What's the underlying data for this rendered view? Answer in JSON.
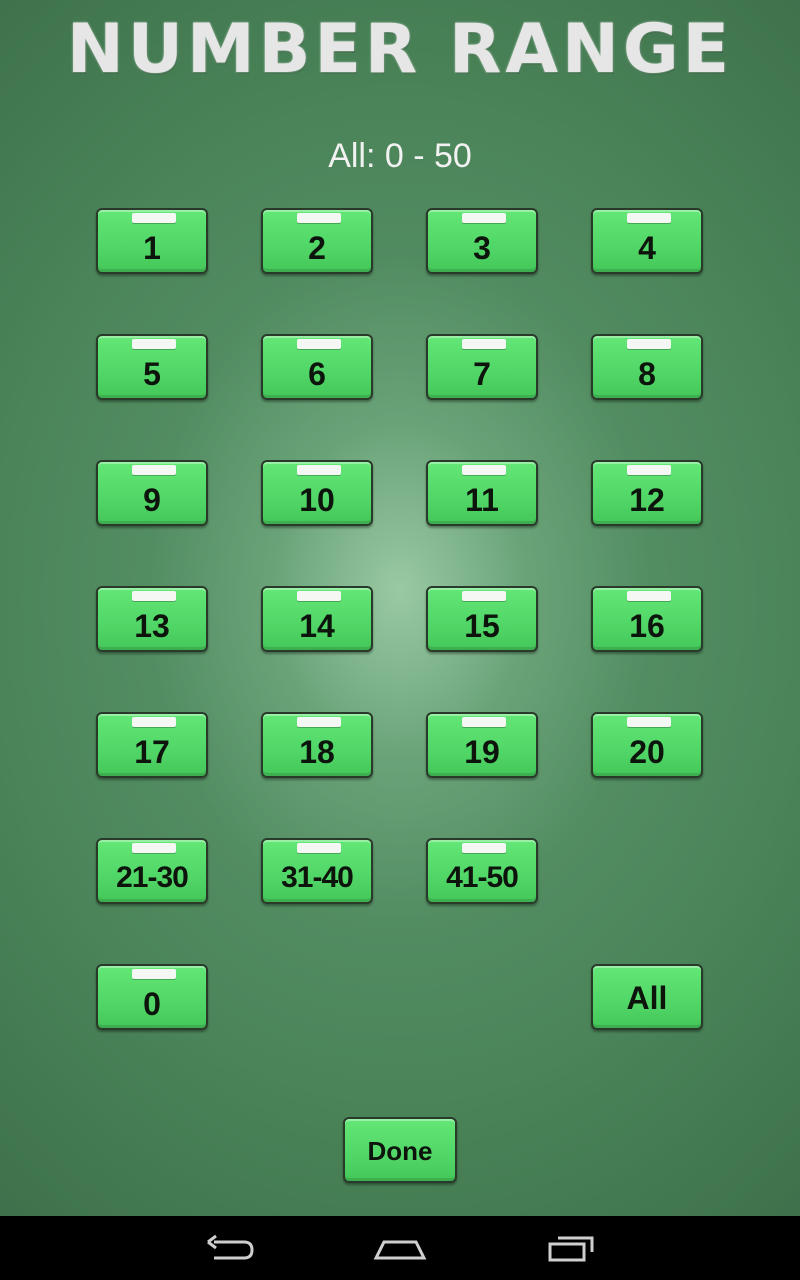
{
  "header": {
    "title": "NUMBER RANGE",
    "range_label": "All: 0 - 50"
  },
  "number_buttons": [
    {
      "label": "1"
    },
    {
      "label": "2"
    },
    {
      "label": "3"
    },
    {
      "label": "4"
    },
    {
      "label": "5"
    },
    {
      "label": "6"
    },
    {
      "label": "7"
    },
    {
      "label": "8"
    },
    {
      "label": "9"
    },
    {
      "label": "10"
    },
    {
      "label": "11"
    },
    {
      "label": "12"
    },
    {
      "label": "13"
    },
    {
      "label": "14"
    },
    {
      "label": "15"
    },
    {
      "label": "16"
    },
    {
      "label": "17"
    },
    {
      "label": "18"
    },
    {
      "label": "19"
    },
    {
      "label": "20"
    }
  ],
  "range_buttons": [
    {
      "label": "21-30"
    },
    {
      "label": "31-40"
    },
    {
      "label": "41-50"
    }
  ],
  "zero_button": {
    "label": "0"
  },
  "all_button": {
    "label": "All"
  },
  "done_button": {
    "label": "Done"
  },
  "colors": {
    "board": "#4b8459",
    "button_fill": "#52d868",
    "button_border": "#2a3a2a",
    "text_light": "#f2f2f2",
    "navbar": "#000000"
  },
  "navbar": {
    "icons": [
      "back-icon",
      "home-icon",
      "recent-apps-icon"
    ]
  }
}
